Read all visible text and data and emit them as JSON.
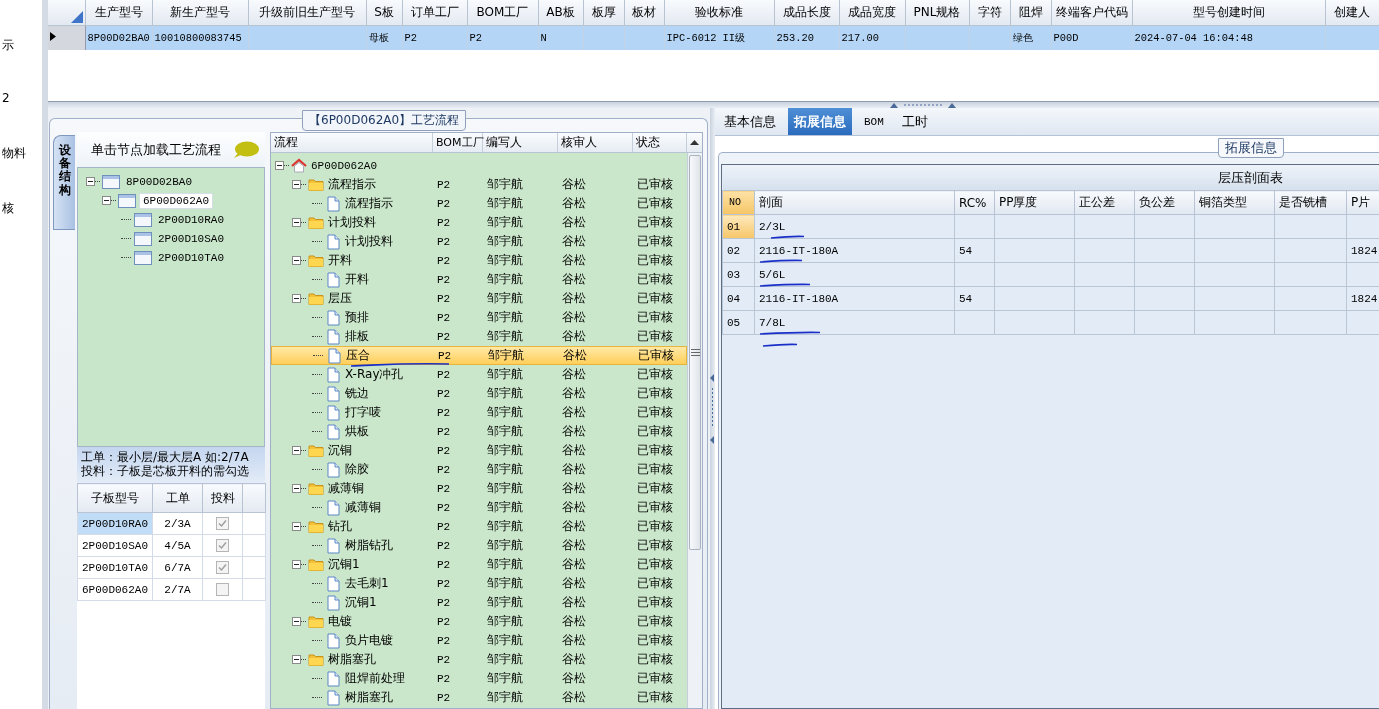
{
  "side_strip": {
    "texts": [
      "示",
      "2",
      "物料",
      "核"
    ]
  },
  "main_grid": {
    "columns": [
      "生产型号",
      "新生产型号",
      "升级前旧生产型号",
      "S板",
      "订单工厂",
      "BOM工厂",
      "AB板",
      "板厚",
      "板材",
      "验收标准",
      "成品长度",
      "成品宽度",
      "PNL规格",
      "字符",
      "阻焊",
      "终端客户代码",
      "型号创建时间",
      "创建人"
    ],
    "rows": [
      {
        "selected": true,
        "cells": [
          "8P00D02BA0",
          "10010800083745",
          null,
          "母板",
          "P2",
          "P2",
          "N",
          null,
          null,
          "IPC-6012 II级",
          "253.20",
          "217.00",
          null,
          null,
          "绿色",
          "P00D",
          "2024-07-04 16:04:48",
          null
        ]
      }
    ]
  },
  "flow_panel": {
    "title": "【6P00D062A0】工艺流程",
    "side_tab": "设备结构",
    "structure": {
      "hint": "单击节点加载工艺流程",
      "tree": [
        {
          "label": "8P00D02BA0",
          "selected": false,
          "expanded": true,
          "children": [
            {
              "label": "6P00D062A0",
              "selected": true,
              "expanded": true,
              "children": [
                {
                  "label": "2P00D10RA0",
                  "selected": false
                },
                {
                  "label": "2P00D10SA0",
                  "selected": false
                },
                {
                  "label": "2P00D10TA0",
                  "selected": false
                }
              ]
            }
          ]
        }
      ],
      "note": [
        "工单：最小层/最大层A 如:2/7A",
        "投料：子板是芯板开料的需勾选"
      ],
      "sub_table": {
        "columns": [
          "子板型号",
          "工单",
          "投料"
        ],
        "rows": [
          {
            "model": "2P00D10RA0",
            "order": "2/3A",
            "feed": true,
            "selected": true
          },
          {
            "model": "2P00D10SA0",
            "order": "4/5A",
            "feed": true,
            "selected": false
          },
          {
            "model": "2P00D10TA0",
            "order": "6/7A",
            "feed": true,
            "selected": false
          },
          {
            "model": "6P00D062A0",
            "order": "2/7A",
            "feed": false,
            "selected": false
          }
        ]
      }
    },
    "process": {
      "columns": [
        "流程",
        "BOM工厂",
        "编写人",
        "核审人",
        "状态"
      ],
      "tree": {
        "label": "6P00D062A0",
        "kind": "root",
        "selected": false,
        "expanded": true,
        "children": [
          {
            "label": "流程指示",
            "kind": "folder",
            "bom": "P2",
            "writer": "邹宇航",
            "reviewer": "谷松",
            "status": "已审核",
            "selected": false,
            "expanded": true,
            "children": [
              {
                "label": "流程指示",
                "kind": "step",
                "bom": "P2",
                "writer": "邹宇航",
                "reviewer": "谷松",
                "status": "已审核",
                "selected": false
              }
            ]
          },
          {
            "label": "计划投料",
            "kind": "folder",
            "bom": "P2",
            "writer": "邹宇航",
            "reviewer": "谷松",
            "status": "已审核",
            "selected": false,
            "expanded": true,
            "children": [
              {
                "label": "计划投料",
                "kind": "step",
                "bom": "P2",
                "writer": "邹宇航",
                "reviewer": "谷松",
                "status": "已审核",
                "selected": false
              }
            ]
          },
          {
            "label": "开料",
            "kind": "folder",
            "bom": "P2",
            "writer": "邹宇航",
            "reviewer": "谷松",
            "status": "已审核",
            "selected": false,
            "expanded": true,
            "children": [
              {
                "label": "开料",
                "kind": "step",
                "bom": "P2",
                "writer": "邹宇航",
                "reviewer": "谷松",
                "status": "已审核",
                "selected": false
              }
            ]
          },
          {
            "label": "层压",
            "kind": "folder",
            "bom": "P2",
            "writer": "邹宇航",
            "reviewer": "谷松",
            "status": "已审核",
            "selected": false,
            "expanded": true,
            "children": [
              {
                "label": "预排",
                "kind": "step",
                "bom": "P2",
                "writer": "邹宇航",
                "reviewer": "谷松",
                "status": "已审核",
                "selected": false
              },
              {
                "label": "排板",
                "kind": "step",
                "bom": "P2",
                "writer": "邹宇航",
                "reviewer": "谷松",
                "status": "已审核",
                "selected": false
              },
              {
                "label": "压合",
                "kind": "step",
                "bom": "P2",
                "writer": "邹宇航",
                "reviewer": "谷松",
                "status": "已审核",
                "selected": true
              },
              {
                "label": "X-Ray冲孔",
                "kind": "step",
                "bom": "P2",
                "writer": "邹宇航",
                "reviewer": "谷松",
                "status": "已审核",
                "selected": false
              },
              {
                "label": "铣边",
                "kind": "step",
                "bom": "P2",
                "writer": "邹宇航",
                "reviewer": "谷松",
                "status": "已审核",
                "selected": false
              },
              {
                "label": "打字唛",
                "kind": "step",
                "bom": "P2",
                "writer": "邹宇航",
                "reviewer": "谷松",
                "status": "已审核",
                "selected": false
              },
              {
                "label": "烘板",
                "kind": "step",
                "bom": "P2",
                "writer": "邹宇航",
                "reviewer": "谷松",
                "status": "已审核",
                "selected": false
              }
            ]
          },
          {
            "label": "沉铜",
            "kind": "folder",
            "bom": "P2",
            "writer": "邹宇航",
            "reviewer": "谷松",
            "status": "已审核",
            "selected": false,
            "expanded": true,
            "children": [
              {
                "label": "除胶",
                "kind": "step",
                "bom": "P2",
                "writer": "邹宇航",
                "reviewer": "谷松",
                "status": "已审核",
                "selected": false
              }
            ]
          },
          {
            "label": "减薄铜",
            "kind": "folder",
            "bom": "P2",
            "writer": "邹宇航",
            "reviewer": "谷松",
            "status": "已审核",
            "selected": false,
            "expanded": true,
            "children": [
              {
                "label": "减薄铜",
                "kind": "step",
                "bom": "P2",
                "writer": "邹宇航",
                "reviewer": "谷松",
                "status": "已审核",
                "selected": false
              }
            ]
          },
          {
            "label": "钻孔",
            "kind": "folder",
            "bom": "P2",
            "writer": "邹宇航",
            "reviewer": "谷松",
            "status": "已审核",
            "selected": false,
            "expanded": true,
            "children": [
              {
                "label": "树脂钻孔",
                "kind": "step",
                "bom": "P2",
                "writer": "邹宇航",
                "reviewer": "谷松",
                "status": "已审核",
                "selected": false
              }
            ]
          },
          {
            "label": "沉铜1",
            "kind": "folder",
            "bom": "P2",
            "writer": "邹宇航",
            "reviewer": "谷松",
            "status": "已审核",
            "selected": false,
            "expanded": true,
            "children": [
              {
                "label": "去毛刺1",
                "kind": "step",
                "bom": "P2",
                "writer": "邹宇航",
                "reviewer": "谷松",
                "status": "已审核",
                "selected": false
              },
              {
                "label": "沉铜1",
                "kind": "step",
                "bom": "P2",
                "writer": "邹宇航",
                "reviewer": "谷松",
                "status": "已审核",
                "selected": false
              }
            ]
          },
          {
            "label": "电镀",
            "kind": "folder",
            "bom": "P2",
            "writer": "邹宇航",
            "reviewer": "谷松",
            "status": "已审核",
            "selected": false,
            "expanded": true,
            "children": [
              {
                "label": "负片电镀",
                "kind": "step",
                "bom": "P2",
                "writer": "邹宇航",
                "reviewer": "谷松",
                "status": "已审核",
                "selected": false
              }
            ]
          },
          {
            "label": "树脂塞孔",
            "kind": "folder",
            "bom": "P2",
            "writer": "邹宇航",
            "reviewer": "谷松",
            "status": "已审核",
            "selected": false,
            "expanded": true,
            "children": [
              {
                "label": "阻焊前处理",
                "kind": "step",
                "bom": "P2",
                "writer": "邹宇航",
                "reviewer": "谷松",
                "status": "已审核",
                "selected": false
              },
              {
                "label": "树脂塞孔",
                "kind": "step",
                "bom": "P2",
                "writer": "邹宇航",
                "reviewer": "谷松",
                "status": "已审核",
                "selected": false
              }
            ]
          }
        ]
      }
    }
  },
  "detail_panel": {
    "tabs": [
      {
        "label": "基本信息",
        "selected": false
      },
      {
        "label": "拓展信息",
        "selected": true
      },
      {
        "label": "BOM",
        "selected": false
      },
      {
        "label": "工时",
        "selected": false
      }
    ],
    "group_title": "拓展信息",
    "table": {
      "title": "层压剖面表",
      "columns": [
        "NO",
        "剖面",
        "RC%",
        "PP厚度",
        "正公差",
        "负公差",
        "铜箔类型",
        "是否铣槽",
        "P片"
      ],
      "rows": [
        {
          "selected": true,
          "cells": [
            "01",
            "2/3L",
            null,
            null,
            null,
            null,
            null,
            null,
            null
          ]
        },
        {
          "selected": false,
          "cells": [
            "02",
            "2116-IT-180A",
            "54",
            null,
            null,
            null,
            null,
            null,
            "1824"
          ]
        },
        {
          "selected": false,
          "cells": [
            "03",
            "5/6L",
            null,
            null,
            null,
            null,
            null,
            null,
            null
          ]
        },
        {
          "selected": false,
          "cells": [
            "04",
            "2116-IT-180A",
            "54",
            null,
            null,
            null,
            null,
            null,
            "1824"
          ]
        },
        {
          "selected": false,
          "cells": [
            "05",
            "7/8L",
            null,
            null,
            null,
            null,
            null,
            null,
            null
          ]
        }
      ]
    }
  }
}
